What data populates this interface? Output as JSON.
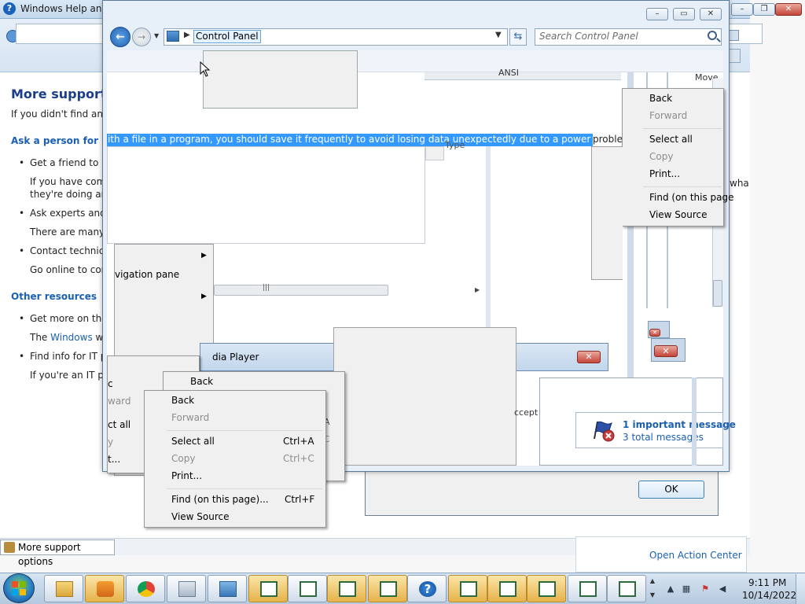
{
  "help": {
    "title": "Windows Help and",
    "heading": "More support o",
    "intro": "If you didn't find an a",
    "ask_heading": "Ask a person for help",
    "bullets": [
      {
        "title": "Get a friend to he",
        "detail1": "If you have comp",
        "detail2": "they're doing and"
      },
      {
        "title": "Ask experts and o",
        "detail1": "There are many k"
      },
      {
        "title": "Contact technica",
        "detail1": "Go online to cont"
      }
    ],
    "other_heading": "Other resources",
    "other_bullets": [
      {
        "title": "Get more on the V",
        "detail_pre": "The ",
        "detail_link": "Windows",
        "detail_post": " we"
      },
      {
        "title": "Find info for IT pr",
        "detail1": "If you're an IT pro"
      }
    ],
    "stray_right": "wha",
    "status_tab": "More support options"
  },
  "control_panel": {
    "address": "Control Panel",
    "search_placeholder": "Search Control Panel",
    "highlighted_text": "ith a file in a program, you should save it frequently to avoid losing data unexpectedly due to a power failure or other",
    "highlight_tail": "problem",
    "type_label": "Type",
    "ansi_label": "ANSI",
    "move_label": "Move",
    "nav_pane_label": "vigation pane",
    "scroll_grip": "|||"
  },
  "media_player": {
    "title_fragment": "dia Player",
    "accept_fragment": "ccept to"
  },
  "context_menu_right": {
    "items": [
      "Back",
      "Forward",
      "Select all",
      "Copy",
      "Print...",
      "Find (on this page",
      "View Source"
    ]
  },
  "context_menu_main": {
    "items": [
      {
        "label": "Back",
        "shortcut": ""
      },
      {
        "label": "Forward",
        "shortcut": ""
      },
      {
        "label": "Select all",
        "shortcut": "Ctrl+A"
      },
      {
        "label": "Copy",
        "shortcut": "Ctrl+C"
      },
      {
        "label": "Print...",
        "shortcut": ""
      },
      {
        "label": "Find (on this page)...",
        "shortcut": "Ctrl+F"
      },
      {
        "label": "View Source",
        "shortcut": ""
      }
    ]
  },
  "context_menu_mid": {
    "back": "Back"
  },
  "context_menu_left": {
    "items": [
      "c",
      "ward",
      "ct all",
      "y",
      "t..."
    ]
  },
  "action_center": {
    "line1": "1 important message",
    "line2": "3 total messages",
    "open_link": "Open Action Center"
  },
  "dialog": {
    "ok": "OK"
  },
  "taskbar": {
    "time": "9:11 PM",
    "date": "10/14/2022",
    "buttons": [
      "explorer-icon",
      "media-player-icon",
      "chrome-icon",
      "calculator-icon",
      "control-panel-icon",
      "window-icon",
      "window-icon",
      "window-icon",
      "window-icon",
      "help-icon",
      "window-icon",
      "window-icon",
      "window-icon",
      "window-icon",
      "window-icon"
    ]
  },
  "colors": {
    "accent": "#1a63b8",
    "selection": "#3399ff",
    "link": "#1a5fb4"
  }
}
